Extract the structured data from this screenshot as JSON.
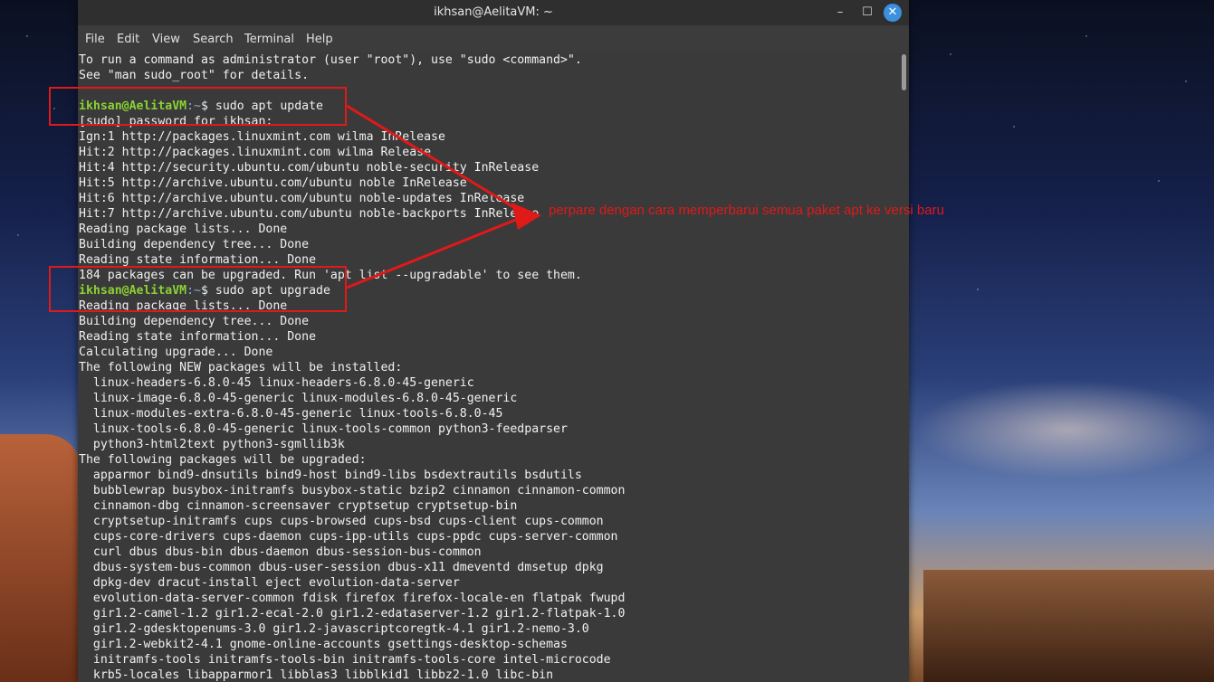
{
  "window": {
    "title": "ikhsan@AelitaVM: ~",
    "minimize": "–",
    "maximize": "☐",
    "close": "✕"
  },
  "menu": [
    "File",
    "Edit",
    "View",
    "Search",
    "Terminal",
    "Help"
  ],
  "terminal": {
    "prompt_user": "ikhsan@AelitaVM",
    "prompt_path": ":~",
    "prompt_symbol": "$ ",
    "cmd_update": "sudo apt update",
    "cmd_upgrade": "sudo apt upgrade",
    "lines": [
      "To run a command as administrator (user \"root\"), use \"sudo <command>\".",
      "See \"man sudo_root\" for details.",
      "",
      "[sudo] password for ikhsan:",
      "Ign:1 http://packages.linuxmint.com wilma InRelease",
      "Hit:2 http://packages.linuxmint.com wilma Release",
      "Hit:4 http://security.ubuntu.com/ubuntu noble-security InRelease",
      "Hit:5 http://archive.ubuntu.com/ubuntu noble InRelease",
      "Hit:6 http://archive.ubuntu.com/ubuntu noble-updates InRelease",
      "Hit:7 http://archive.ubuntu.com/ubuntu noble-backports InRelease",
      "Reading package lists... Done",
      "Building dependency tree... Done",
      "Reading state information... Done",
      "184 packages can be upgraded. Run 'apt list --upgradable' to see them.",
      "Reading package lists... Done",
      "Building dependency tree... Done",
      "Reading state information... Done",
      "Calculating upgrade... Done",
      "The following NEW packages will be installed:",
      "  linux-headers-6.8.0-45 linux-headers-6.8.0-45-generic",
      "  linux-image-6.8.0-45-generic linux-modules-6.8.0-45-generic",
      "  linux-modules-extra-6.8.0-45-generic linux-tools-6.8.0-45",
      "  linux-tools-6.8.0-45-generic linux-tools-common python3-feedparser",
      "  python3-html2text python3-sgmllib3k",
      "The following packages will be upgraded:",
      "  apparmor bind9-dnsutils bind9-host bind9-libs bsdextrautils bsdutils",
      "  bubblewrap busybox-initramfs busybox-static bzip2 cinnamon cinnamon-common",
      "  cinnamon-dbg cinnamon-screensaver cryptsetup cryptsetup-bin",
      "  cryptsetup-initramfs cups cups-browsed cups-bsd cups-client cups-common",
      "  cups-core-drivers cups-daemon cups-ipp-utils cups-ppdc cups-server-common",
      "  curl dbus dbus-bin dbus-daemon dbus-session-bus-common",
      "  dbus-system-bus-common dbus-user-session dbus-x11 dmeventd dmsetup dpkg",
      "  dpkg-dev dracut-install eject evolution-data-server",
      "  evolution-data-server-common fdisk firefox firefox-locale-en flatpak fwupd",
      "  gir1.2-camel-1.2 gir1.2-ecal-2.0 gir1.2-edataserver-1.2 gir1.2-flatpak-1.0",
      "  gir1.2-gdesktopenums-3.0 gir1.2-javascriptcoregtk-4.1 gir1.2-nemo-3.0",
      "  gir1.2-webkit2-4.1 gnome-online-accounts gsettings-desktop-schemas",
      "  initramfs-tools initramfs-tools-bin initramfs-tools-core intel-microcode",
      "  krb5-locales libapparmor1 libblas3 libblkid1 libbz2-1.0 libc-bin"
    ]
  },
  "annotation": {
    "text": "perpare dengan cara memperbarui semua paket apt ke versi baru",
    "color": "#e01919"
  }
}
